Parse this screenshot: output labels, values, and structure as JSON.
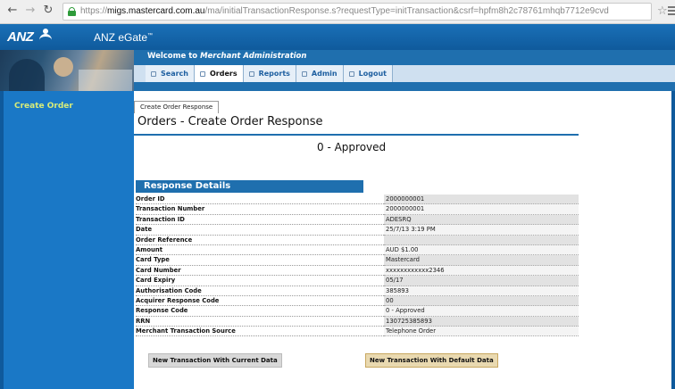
{
  "browser": {
    "url_scheme": "https://",
    "url_host": "migs.mastercard.com.au",
    "url_path": "/ma/initialTransactionResponse.s?requestType=initTransaction&csrf=hpfm8h2c78761mhqb7712e9cvd",
    "icons": [
      "back-icon",
      "forward-icon",
      "reload-icon",
      "lock-icon",
      "star-icon",
      "menu-icon"
    ]
  },
  "header": {
    "logo": "ANZ",
    "app_name": "ANZ eGate",
    "app_name_mark": "™",
    "welcome_prefix": "Welcome to ",
    "welcome_emphasis": "Merchant Administration"
  },
  "nav": {
    "items": [
      {
        "label": "Search"
      },
      {
        "label": "Orders",
        "active": true
      },
      {
        "label": "Reports"
      },
      {
        "label": "Admin"
      },
      {
        "label": "Logout"
      }
    ]
  },
  "sidebar": {
    "items": [
      {
        "label": "Create Order"
      }
    ]
  },
  "main": {
    "crumb_tab": "Create Order Response",
    "title": "Orders - Create Order Response",
    "status": "0 - Approved",
    "section_title": "Response Details",
    "rows": [
      {
        "label": "Order ID",
        "value": "2000000001"
      },
      {
        "label": "Transaction Number",
        "value": "2000000001"
      },
      {
        "label": "Transaction ID",
        "value": "ADESRQ"
      },
      {
        "label": "Date",
        "value": "25/7/13 3:19 PM"
      },
      {
        "label": "Order Reference",
        "value": ""
      },
      {
        "label": "Amount",
        "value": "AUD $1.00"
      },
      {
        "label": "Card Type",
        "value": "Mastercard"
      },
      {
        "label": "Card Number",
        "value": "xxxxxxxxxxxx2346"
      },
      {
        "label": "Card Expiry",
        "value": "05/17"
      },
      {
        "label": "Authorisation Code",
        "value": "385893"
      },
      {
        "label": "Acquirer Response Code",
        "value": "00"
      },
      {
        "label": "Response Code",
        "value": "0 - Approved"
      },
      {
        "label": "RRN",
        "value": "130725385893"
      },
      {
        "label": "Merchant Transaction Source",
        "value": "Telephone Order"
      }
    ],
    "button_current": "New Transaction With Current Data",
    "button_default": "New Transaction With Default Data"
  },
  "colors": {
    "brand_blue": "#1f6fae",
    "sidebar_blue": "#1a78c6",
    "sidebar_link": "#d7ec7a",
    "default_button": "#e9d9b0"
  }
}
